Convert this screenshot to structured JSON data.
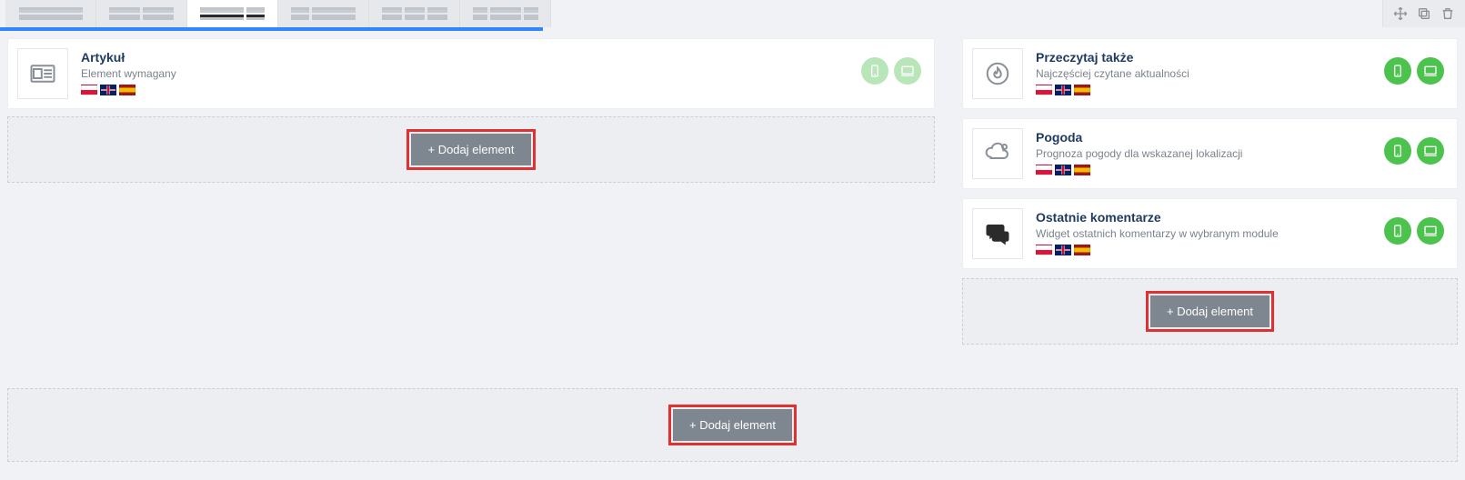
{
  "buttons": {
    "add_element": "+ Dodaj element"
  },
  "left": {
    "cards": [
      {
        "title": "Artykuł",
        "subtitle": "Element wymagany",
        "device_soft": true
      }
    ]
  },
  "right": {
    "cards": [
      {
        "title": "Przeczytaj także",
        "subtitle": "Najczęściej czytane aktualności"
      },
      {
        "title": "Pogoda",
        "subtitle": "Prognoza pogody dla wskazanej lokalizacji"
      },
      {
        "title": "Ostatnie komentarze",
        "subtitle": "Widget ostatnich komentarzy w wybranym module"
      }
    ]
  }
}
